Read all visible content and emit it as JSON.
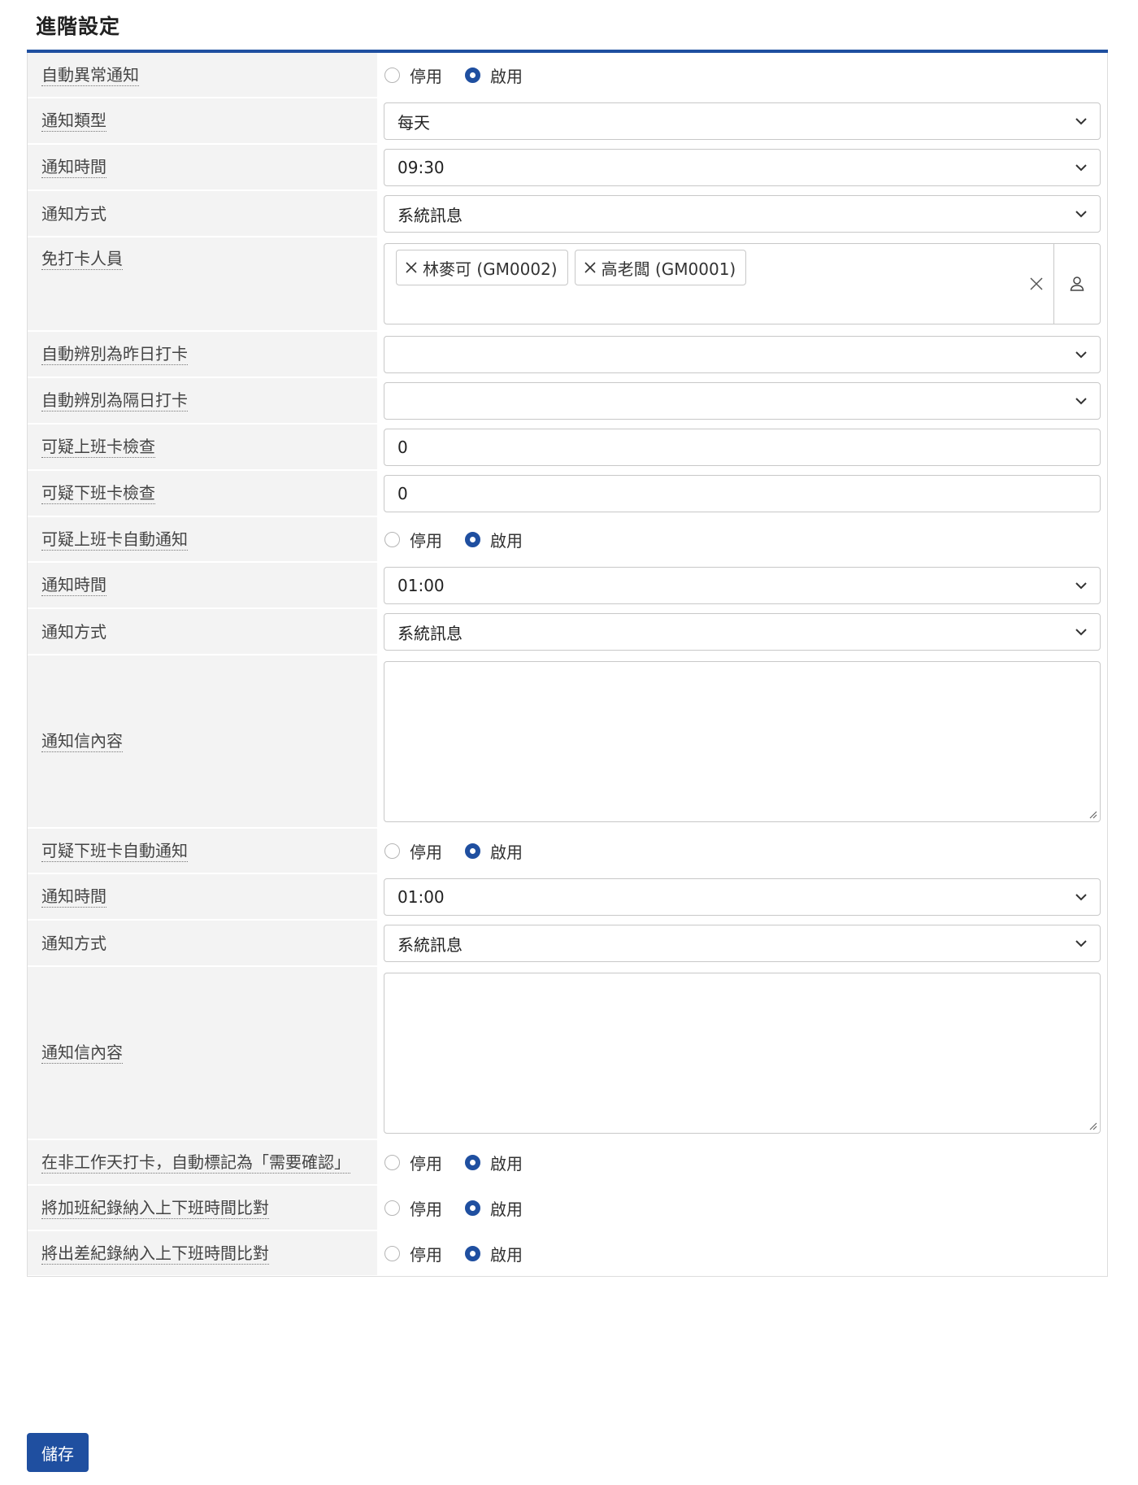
{
  "section": {
    "title": "進階設定"
  },
  "options": {
    "off": "停用",
    "on": "啟用"
  },
  "rows": {
    "auto_alert": {
      "label": "自動異常通知",
      "selected": "啟用"
    },
    "notify_type": {
      "label": "通知類型",
      "value": "每天"
    },
    "notify_time": {
      "label": "通知時間",
      "value": "09:30"
    },
    "notify_method": {
      "label": "通知方式",
      "value": "系統訊息"
    },
    "exempt": {
      "label": "免打卡人員",
      "tags": [
        "林麥可 (GM0002)",
        "高老闆 (GM0001)"
      ]
    },
    "yesterday": {
      "label": "自動辨別為昨日打卡",
      "value": ""
    },
    "next_day": {
      "label": "自動辨別為隔日打卡",
      "value": ""
    },
    "susp_in_check": {
      "label": "可疑上班卡檢查",
      "value": "0"
    },
    "susp_out_check": {
      "label": "可疑下班卡檢查",
      "value": "0"
    },
    "susp_in_auto": {
      "label": "可疑上班卡自動通知",
      "selected": "啟用"
    },
    "susp_in_time": {
      "label": "通知時間",
      "value": "01:00"
    },
    "susp_in_method": {
      "label": "通知方式",
      "value": "系統訊息"
    },
    "susp_in_content": {
      "label": "通知信內容",
      "value": ""
    },
    "susp_out_auto": {
      "label": "可疑下班卡自動通知",
      "selected": "啟用"
    },
    "susp_out_time": {
      "label": "通知時間",
      "value": "01:00"
    },
    "susp_out_method": {
      "label": "通知方式",
      "value": "系統訊息"
    },
    "susp_out_content": {
      "label": "通知信內容",
      "value": ""
    },
    "non_workday": {
      "label": "在非工作天打卡，自動標記為「需要確認」",
      "selected": "啟用"
    },
    "overtime_compare": {
      "label": "將加班紀錄納入上下班時間比對",
      "selected": "啟用"
    },
    "trip_compare": {
      "label": "將出差紀錄納入上下班時間比對",
      "selected": "啟用"
    }
  },
  "buttons": {
    "save": "儲存"
  },
  "colors": {
    "accent": "#1f4fa0",
    "label_bg": "#f3f3f3",
    "border": "#c8c8c8"
  },
  "icons": {
    "dropdown": "chevron-down-icon",
    "remove_tag": "close-icon",
    "clear": "close-icon",
    "people": "user-icon",
    "resize": "resize-handle-icon"
  }
}
